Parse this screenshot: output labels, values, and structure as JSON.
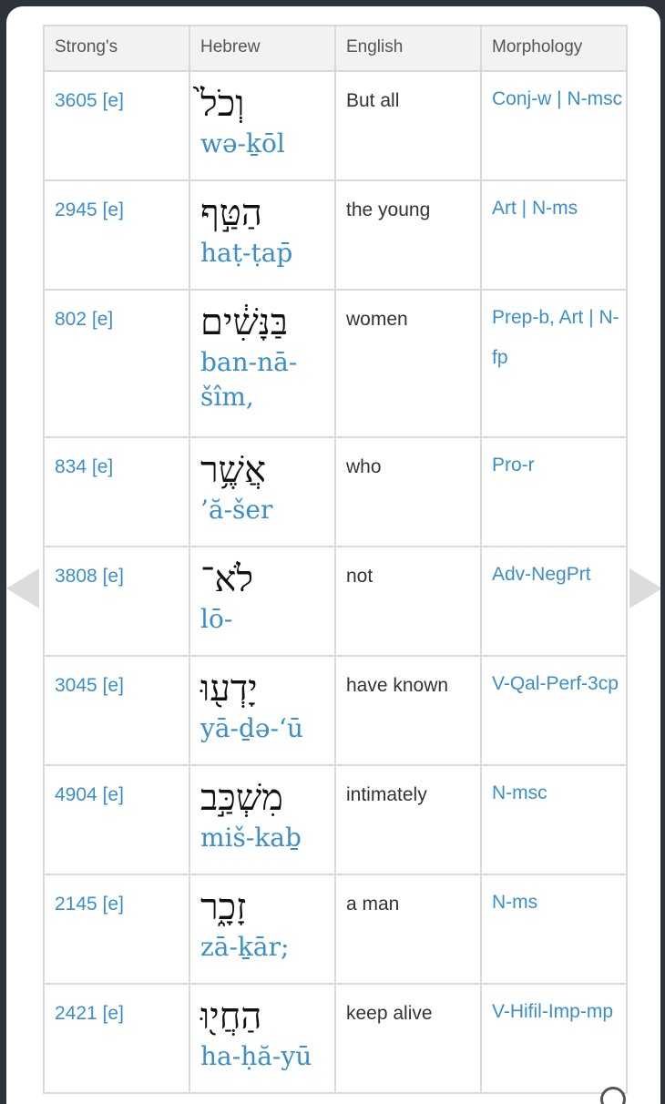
{
  "table": {
    "headers": [
      "Strong's",
      "Hebrew",
      "English",
      "Morphology"
    ],
    "rows": [
      {
        "strong": "3605 [e]",
        "hebrew": "וְכֹל֙",
        "translit": "wə-ḵōl",
        "english": "But all",
        "morph": "Conj-w | N-msc"
      },
      {
        "strong": "2945 [e]",
        "hebrew": "הַטַּ֣ף",
        "translit": "haṭ-ṭap̄",
        "english": "the young",
        "morph": "Art | N-ms"
      },
      {
        "strong": "802 [e]",
        "hebrew": "בַּנָּשִׁ֔ים",
        "translit": "ban-nā-šîm,",
        "english": "women",
        "morph": "Prep-b, Art | N-fp"
      },
      {
        "strong": "834 [e]",
        "hebrew": "אֲשֶׁ֥ר",
        "translit": "’ă-šer",
        "english": "who",
        "morph": "Pro-r"
      },
      {
        "strong": "3808 [e]",
        "hebrew": "לֹא־",
        "translit": "lō-",
        "english": "not",
        "morph": "Adv-NegPrt"
      },
      {
        "strong": "3045 [e]",
        "hebrew": "יָדְע֖וּ",
        "translit": "yā-ḏə-‘ū",
        "english": "have known",
        "morph": "V-Qal-Perf-3cp"
      },
      {
        "strong": "4904 [e]",
        "hebrew": "מִשְׁכַּ֣ב",
        "translit": "miš-kaḇ",
        "english": "intimately",
        "morph": "N-msc"
      },
      {
        "strong": "2145 [e]",
        "hebrew": "זָכָ֑ר",
        "translit": "zā-ḵār;",
        "english": "a man",
        "morph": "N-ms"
      },
      {
        "strong": "2421 [e]",
        "hebrew": "הַחֲי֖וּ",
        "translit": "ha-ḥă-yū",
        "english": "keep alive",
        "morph": "V-Hifil-Imp-mp"
      }
    ]
  },
  "colors": {
    "link": "#3a8fc9",
    "border": "#d9d9d9",
    "header_bg": "#f2f2f2",
    "backdrop": "#2e323a"
  },
  "icons": {
    "left": "chevron-left-icon",
    "right": "chevron-right-icon",
    "zoom": "zoom-icon"
  }
}
